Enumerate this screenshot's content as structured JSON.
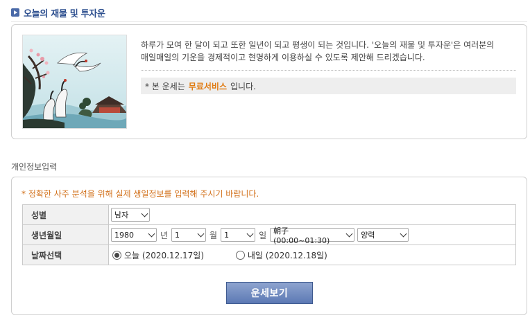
{
  "page_title": "오늘의 재물 및 투자운",
  "intro": {
    "description": "하루가 모여 한 달이 되고 또한 일년이 되고 평생이 되는 것입니다. '오늘의 재물 및 투자운'은 여러분의 매일매일의 기운을 경제적이고 현명하게 이용하실 수 있도록 제안해 드리겠습니다.",
    "notice_prefix": "* 본 운세는",
    "notice_free": "무료서비스",
    "notice_suffix": "입니다."
  },
  "section_label": "개인정보입력",
  "form": {
    "hint": "* 정확한 사주 분석을 위해 실제 생일정보를 입력해 주시기 바랍니다.",
    "gender": {
      "label": "성별",
      "value": "남자"
    },
    "birth": {
      "label": "생년월일",
      "year": "1980",
      "year_unit": "년",
      "month": "1",
      "month_unit": "월",
      "day": "1",
      "day_unit": "일",
      "hour": "朝子(00:00~01:30)",
      "calendar": "양력"
    },
    "date_choice": {
      "label": "날짜선택",
      "today": "오늘 (2020.12.17일)",
      "tomorrow": "내일 (2020.12.18일)",
      "selected": "today"
    },
    "submit_label": "운세보기"
  },
  "colors": {
    "title": "#2d4f8f",
    "hint": "#d2701a",
    "free_text": "#e07a10",
    "button": "#6a84bb"
  },
  "icons": [
    "title-bullet-icon",
    "chevron-down-icon",
    "radio-icon"
  ]
}
